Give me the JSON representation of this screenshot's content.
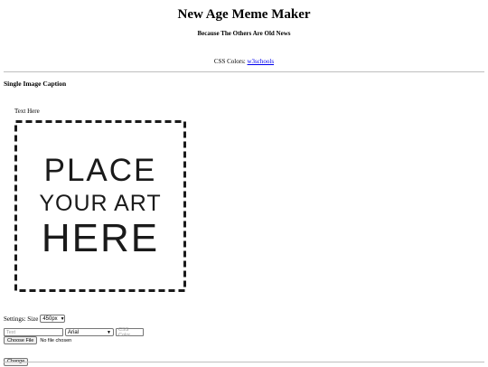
{
  "header": {
    "title": "New Age Meme Maker",
    "subtitle": "Because The Others Are Old News",
    "css_colors_label": "CSS Colors:",
    "css_colors_link": "w3schools"
  },
  "section": {
    "title": "Single Image Caption",
    "caption_text": "Text Here"
  },
  "art": {
    "line1": "PLACE",
    "line2": "YOUR ART",
    "line3": "HERE"
  },
  "settings": {
    "label": "Settings: Size",
    "size_value": "450px"
  },
  "form": {
    "text_placeholder": "Text",
    "font_value": "Arial",
    "color_placeholder": "CSS Color",
    "choose_file_label": "Choose File",
    "no_file_text": "No file chosen",
    "change_label": "Change"
  },
  "icons": {
    "select_chevron": "chevron-down-icon"
  }
}
